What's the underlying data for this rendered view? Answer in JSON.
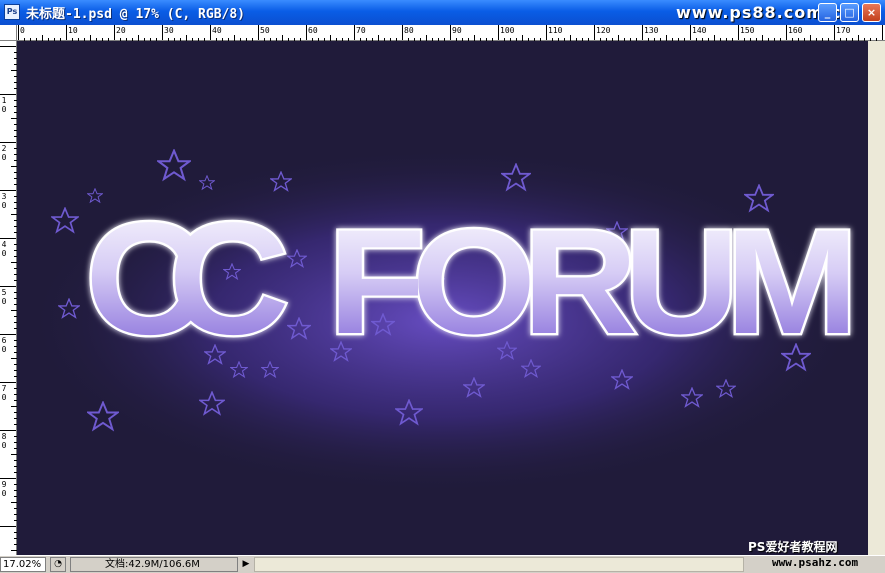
{
  "window": {
    "title": "未标题-1.psd @ 17% (C, RGB/8)",
    "app_icon": "photoshop-document-icon",
    "app_icon_text": "Ps",
    "watermark": "www.ps88.com.cn",
    "controls": {
      "minimize": "_",
      "maximize": "□",
      "close": "×"
    }
  },
  "rulers": {
    "top_labels": [
      "0",
      "10",
      "20",
      "30",
      "40",
      "50",
      "60",
      "70",
      "80",
      "90",
      "100",
      "110",
      "120",
      "130",
      "140",
      "150",
      "160",
      "170"
    ],
    "left_labels": [
      "1 0",
      "2 0",
      "3 0",
      "4 0",
      "5 0",
      "6 0",
      "7 0",
      "8 0",
      "9 0"
    ]
  },
  "canvas": {
    "background": "#201b3a",
    "glow": "#6a4fc8",
    "text_line1": "CC",
    "text_line2": "FORUM",
    "letter_fill_top": "#ffffff",
    "letter_fill_bottom": "#7b5fd6",
    "star_color": "#6f5ad0"
  },
  "status": {
    "zoom": "17.02%",
    "doc_info": "文档:42.9M/106.6M",
    "menu_arrow": "▶",
    "watermark_cn": "PS爱好者教程网",
    "watermark_url": "www.psahz.com"
  }
}
